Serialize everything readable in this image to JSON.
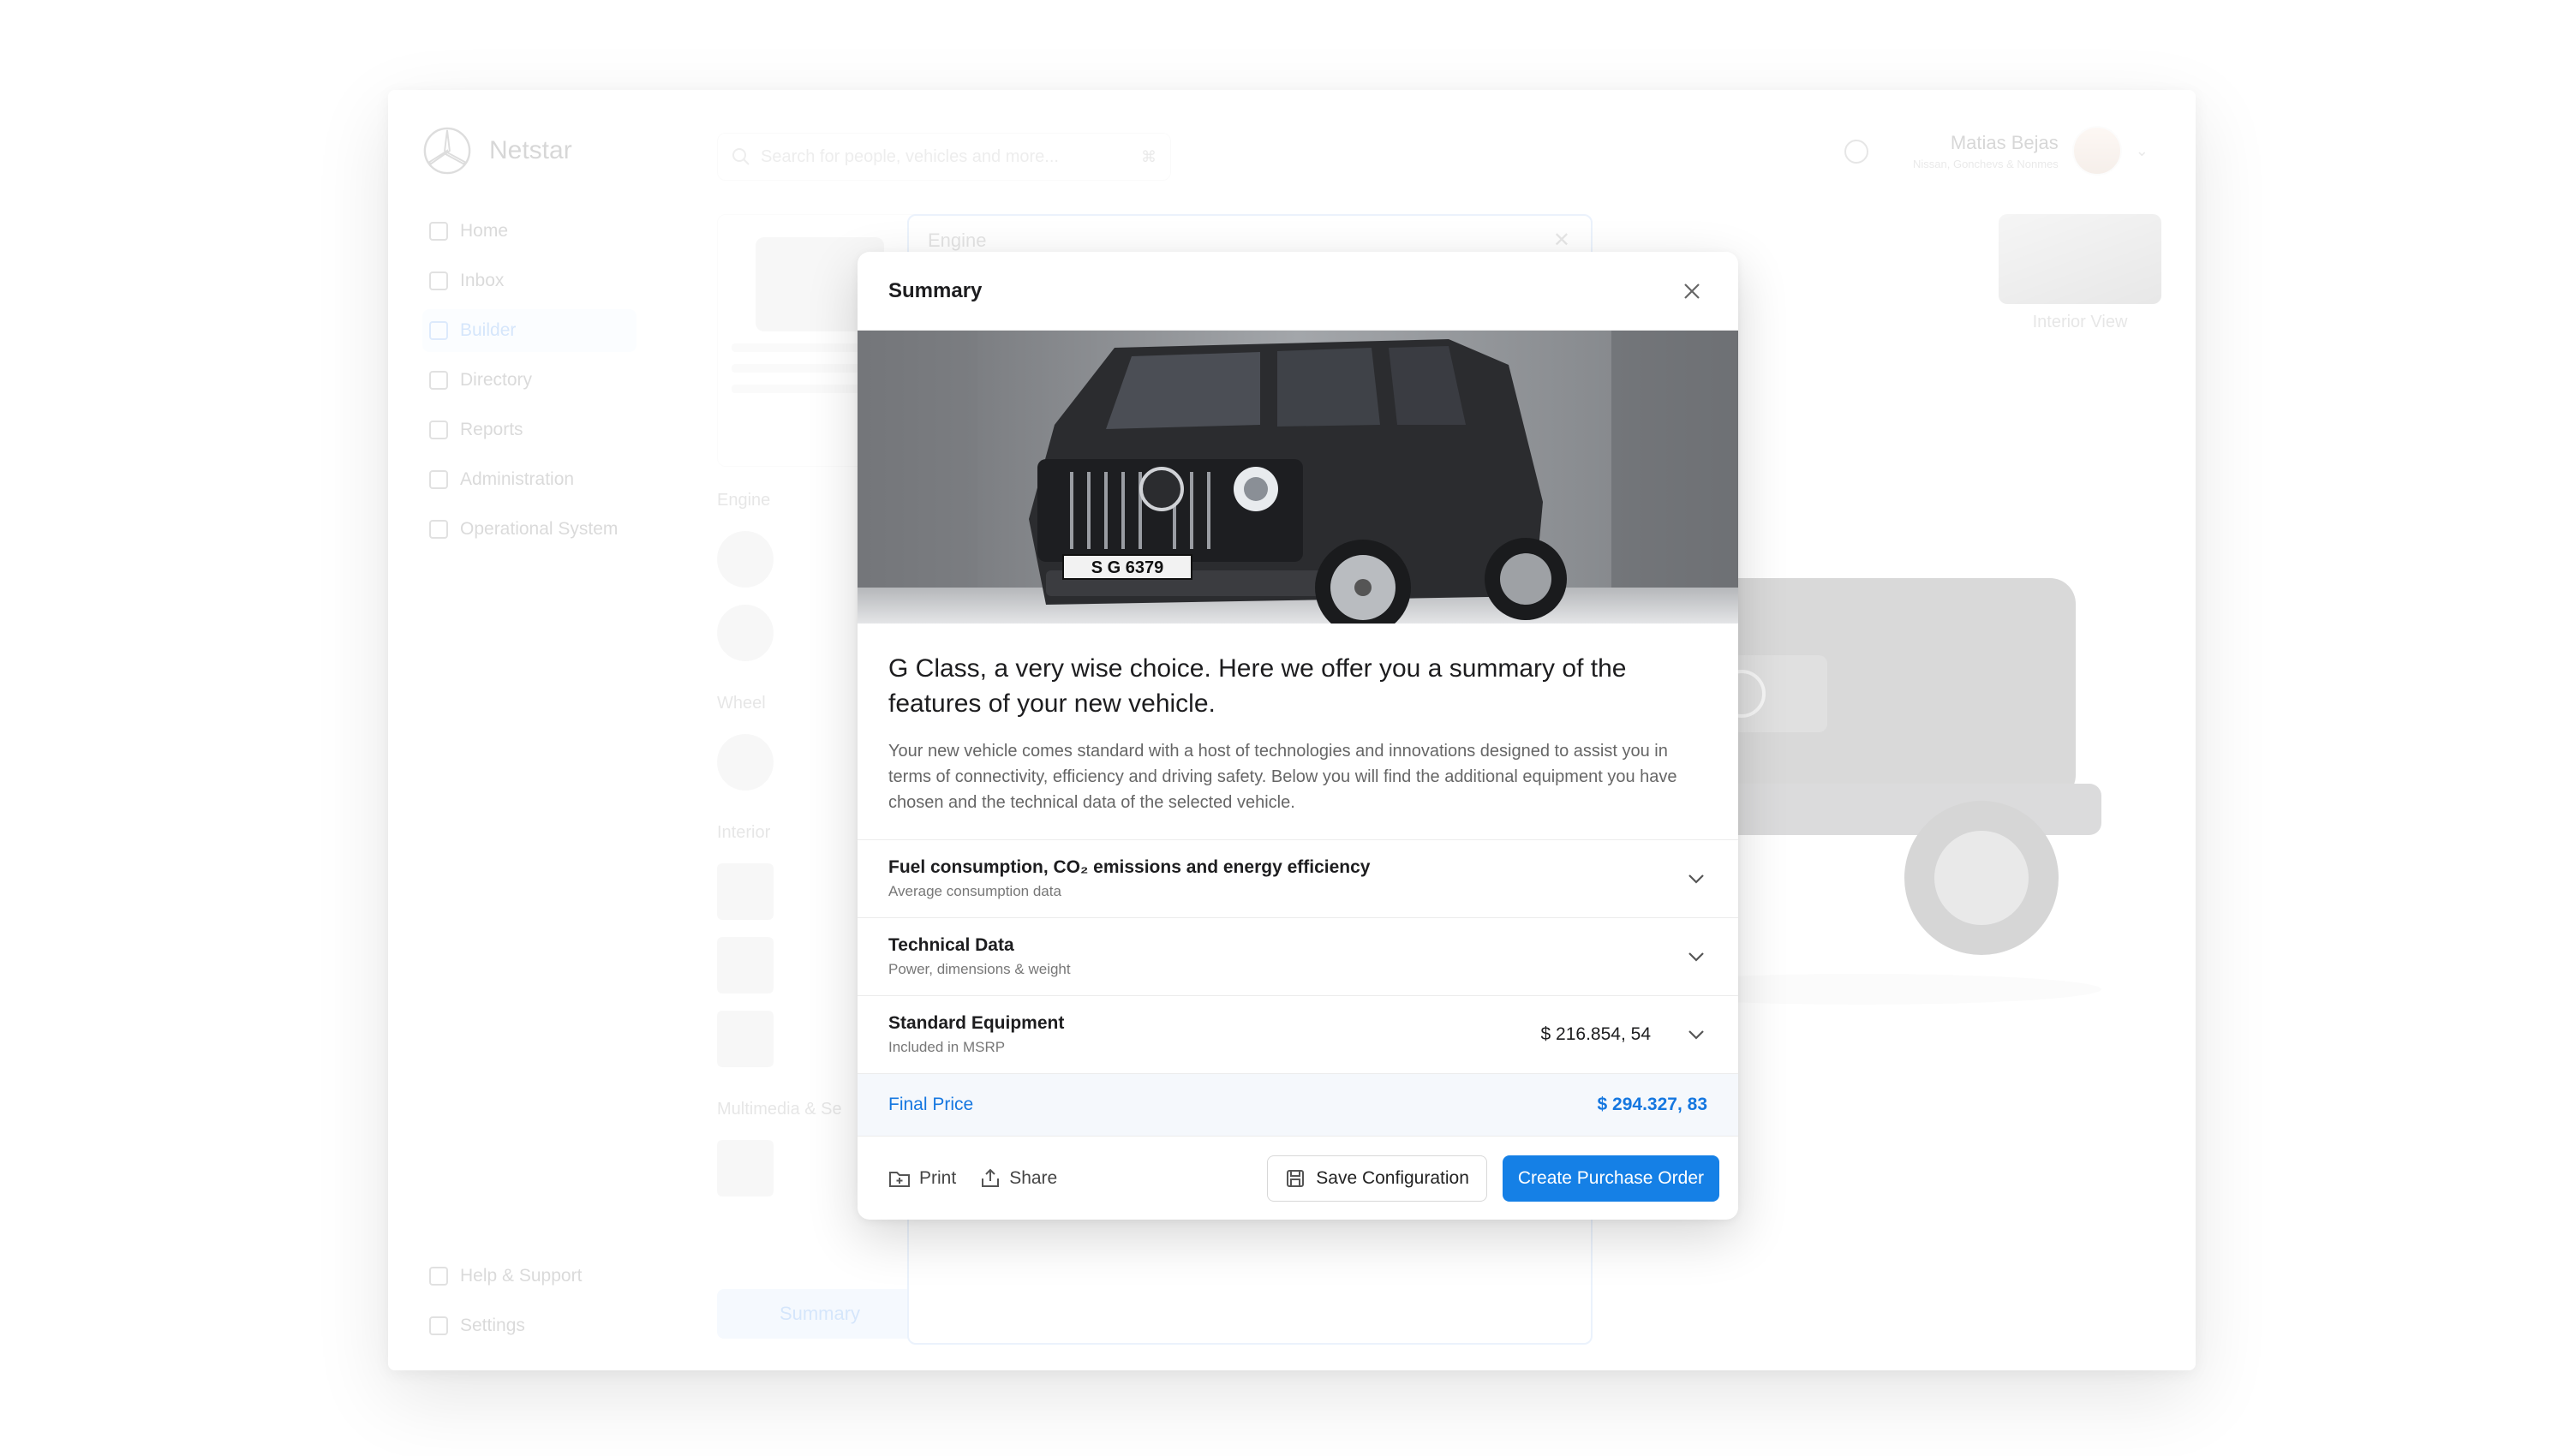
{
  "app": {
    "name": "Netstar",
    "search_placeholder": "Search for people, vehicles and more...",
    "search_shortcut": "⌘",
    "user": {
      "name": "Matias Bejas",
      "role": "Nissan, Gonchevs & Nonmes"
    }
  },
  "sidebar": {
    "items": [
      {
        "label": "Home"
      },
      {
        "label": "Inbox"
      },
      {
        "label": "Builder"
      },
      {
        "label": "Directory"
      },
      {
        "label": "Reports"
      },
      {
        "label": "Administration"
      },
      {
        "label": "Operational System"
      }
    ],
    "bottom": [
      {
        "label": "Help & Support"
      },
      {
        "label": "Settings"
      }
    ]
  },
  "background": {
    "builder_sections": [
      "Engine",
      "Wheel",
      "Interior",
      "Multimedia & Se"
    ],
    "engine_panel_title": "Engine",
    "interior_label": "Interior View",
    "summary_button": "Summary"
  },
  "modal": {
    "title": "Summary",
    "heading": "G Class, a very wise choice. Here we offer you a summary of the features of your new vehicle.",
    "body": "Your new vehicle comes standard with a host of technologies and innovations designed to assist you in terms of connectivity, efficiency and driving safety. Below you will find the additional equipment you have chosen and the technical data of the selected vehicle.",
    "plate": "S G 6379",
    "accordion": [
      {
        "title": "Fuel consumption, CO₂ emissions and energy efficiency",
        "subtitle": "Average consumption data",
        "price": ""
      },
      {
        "title": "Technical Data",
        "subtitle": "Power, dimensions & weight",
        "price": ""
      },
      {
        "title": "Standard Equipment",
        "subtitle": "Included in MSRP",
        "price": "$ 216.854, 54"
      }
    ],
    "final": {
      "label": "Final Price",
      "value": "$ 294.327, 83"
    },
    "footer": {
      "print": "Print",
      "share": "Share",
      "save": "Save Configuration",
      "create": "Create Purchase Order"
    }
  },
  "colors": {
    "accent": "#1580e6",
    "final_price": "#1577e0"
  }
}
